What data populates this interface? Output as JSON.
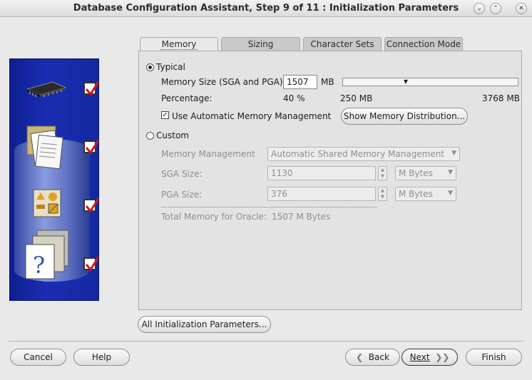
{
  "window": {
    "title": "Database Configuration Assistant, Step 9 of 11 : Initialization Parameters"
  },
  "tabs": [
    {
      "label": "Memory",
      "active": true
    },
    {
      "label": "Sizing",
      "active": false
    },
    {
      "label": "Character Sets",
      "active": false
    },
    {
      "label": "Connection Mode",
      "active": false
    }
  ],
  "memory": {
    "typical_label": "Typical",
    "typical_selected": true,
    "memory_size_label": "Memory Size (SGA and PGA):",
    "memory_size_value": "1507",
    "memory_size_unit": "MB",
    "percentage_label": "Percentage:",
    "percentage_value": "40 %",
    "slider_min": "250 MB",
    "slider_max": "3768 MB",
    "slider_fraction": 0.35,
    "use_amm_label": "Use Automatic Memory Management",
    "use_amm_checked": true,
    "show_distribution_button": "Show Memory Distribution...",
    "custom_label": "Custom",
    "custom_selected": false,
    "memory_management_label": "Memory Management",
    "memory_management_value": "Automatic Shared Memory Management",
    "sga_size_label": "SGA Size:",
    "sga_size_value": "1130",
    "sga_unit": "M Bytes",
    "pga_size_label": "PGA Size:",
    "pga_size_value": "376",
    "pga_unit": "M Bytes",
    "total_memory_label": "Total Memory for Oracle:",
    "total_memory_value": "1507 M Bytes"
  },
  "all_params_button": "All Initialization Parameters...",
  "footer": {
    "cancel": "Cancel",
    "help": "Help",
    "back": "Back",
    "next": "Next",
    "finish": "Finish"
  },
  "colors": {
    "side_panel": "#1a2db3",
    "checkmark": "#cc1a1a"
  }
}
